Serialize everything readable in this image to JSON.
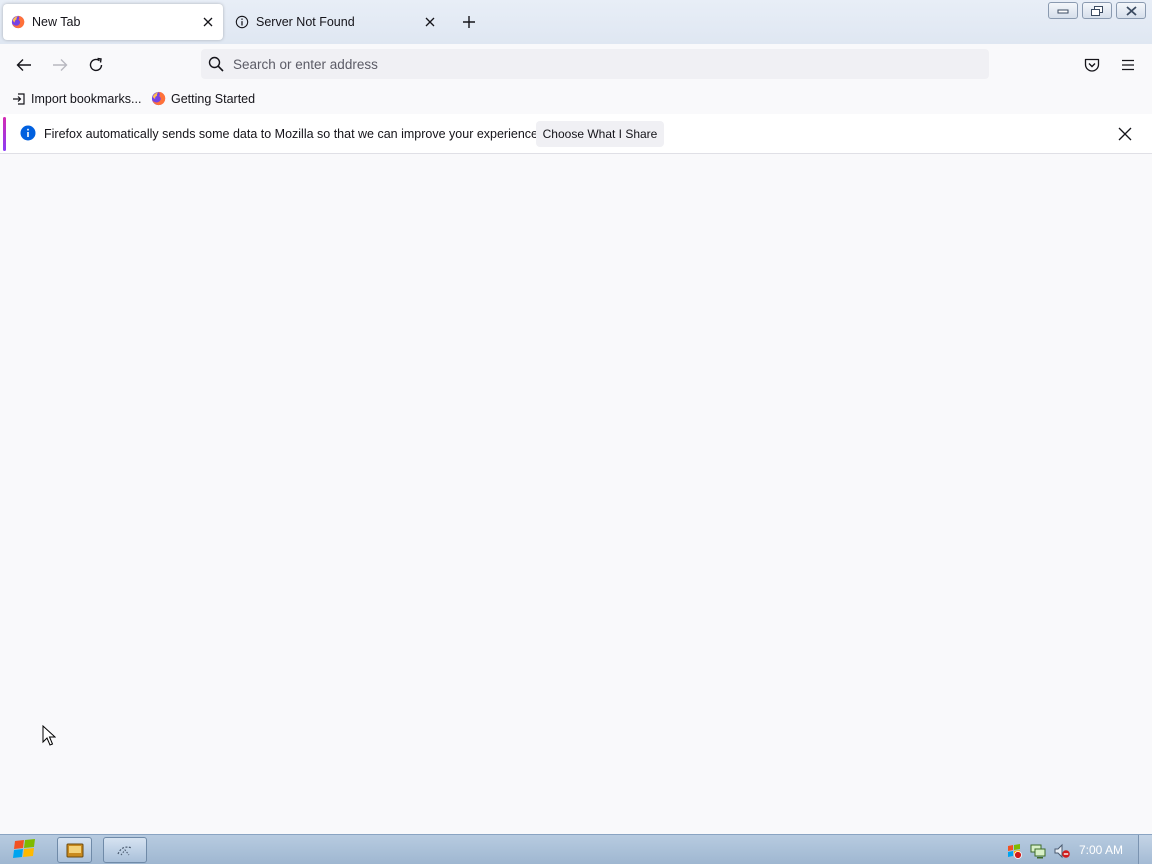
{
  "tabs": [
    {
      "title": "New Tab",
      "icon": "firefox-icon",
      "active": true
    },
    {
      "title": "Server Not Found",
      "icon": "info-icon",
      "active": false
    }
  ],
  "urlbar": {
    "placeholder": "Search or enter address",
    "value": ""
  },
  "bookmarks": [
    {
      "label": "Import bookmarks...",
      "icon": "import-icon"
    },
    {
      "label": "Getting Started",
      "icon": "firefox-icon"
    }
  ],
  "notification": {
    "message": "Firefox automatically sends some data to Mozilla so that we can improve your experience.",
    "button_label": "Choose What I Share"
  },
  "taskbar": {
    "clock": "7:00 AM"
  },
  "colors": {
    "accent_start": "#d42ab3",
    "accent_end": "#8a3cf5",
    "info_blue": "#0060df",
    "page_bg": "#f9f9fb"
  }
}
